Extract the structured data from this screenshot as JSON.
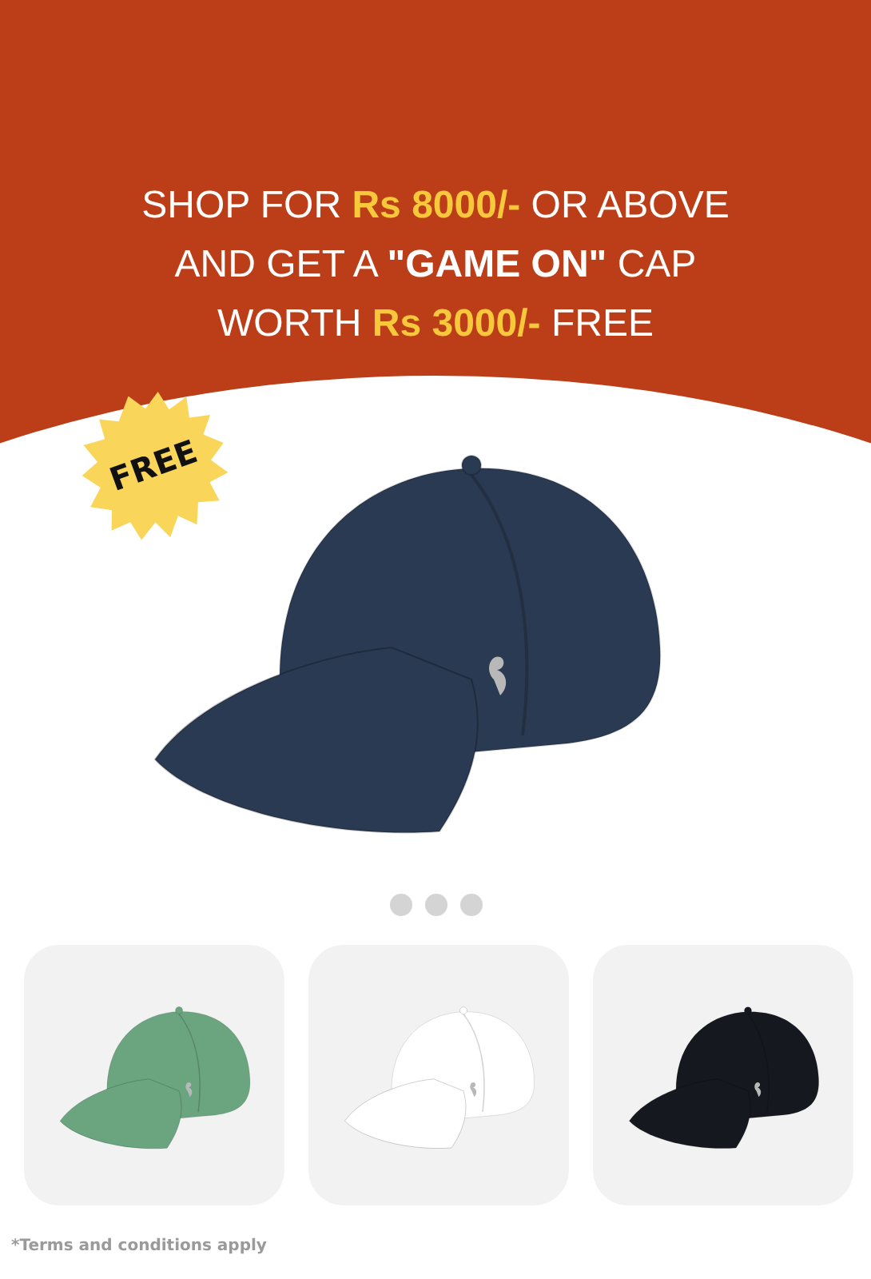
{
  "headline": {
    "lines": [
      [
        {
          "kind": "plain",
          "text": "SHOP FOR "
        },
        {
          "kind": "price",
          "text": "Rs 8000/-"
        },
        {
          "kind": "plain",
          "text": " OR ABOVE"
        }
      ],
      [
        {
          "kind": "plain",
          "text": "AND GET A "
        },
        {
          "kind": "name",
          "text": "\"GAME ON\""
        },
        {
          "kind": "plain",
          "text": " CAP"
        }
      ],
      [
        {
          "kind": "plain",
          "text": "WORTH "
        },
        {
          "kind": "price",
          "text": "Rs 3000/-"
        },
        {
          "kind": "plain",
          "text": " FREE"
        }
      ]
    ]
  },
  "badge": {
    "text": "FREE"
  },
  "hero_product": {
    "color": "#2a3a52"
  },
  "variants": [
    {
      "color": "#6aa57f"
    },
    {
      "color": "#ffffff"
    },
    {
      "color": "#15181f"
    }
  ],
  "footnote": "*Terms and conditions apply"
}
